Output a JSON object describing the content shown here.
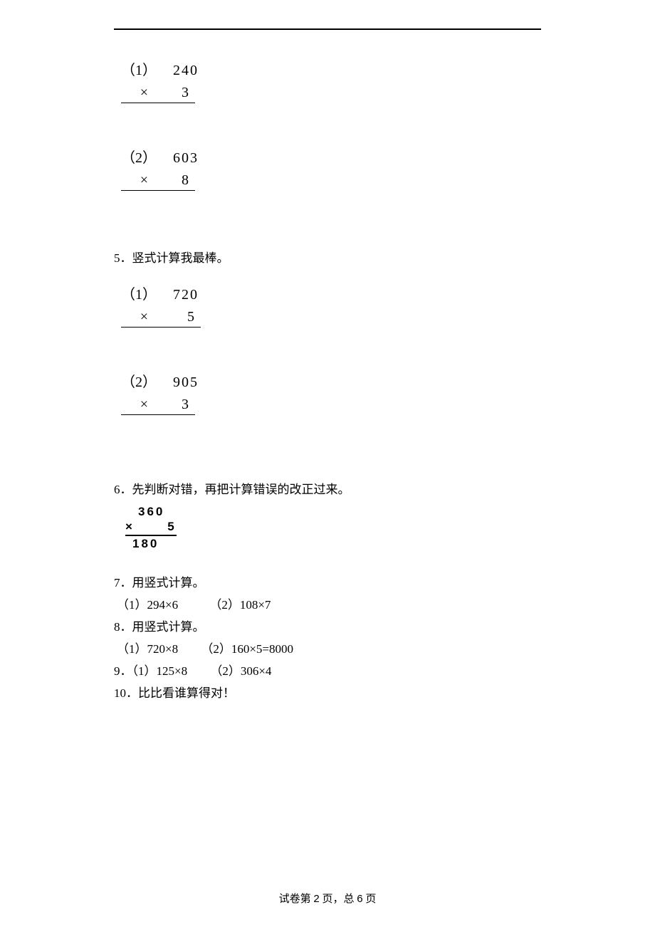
{
  "q4": {
    "p1": {
      "label": "（1）",
      "operand": "240",
      "sign": "×",
      "multiplier": "3"
    },
    "p2": {
      "label": "（2）",
      "operand": "603",
      "sign": "×",
      "multiplier": "8"
    }
  },
  "q5": {
    "title": "5．竖式计算我最棒。",
    "p1": {
      "label": "（1）",
      "operand": "720",
      "sign": "×",
      "multiplier": "5"
    },
    "p2": {
      "label": "（2）",
      "operand": "905",
      "sign": "×",
      "multiplier": "3"
    }
  },
  "q6": {
    "title": "6．先判断对错，再把计算错误的改正过来。",
    "top": "360",
    "sign": "×",
    "mult": "5",
    "result": "180"
  },
  "q7": {
    "title": "7．用竖式计算。",
    "p1": "（1）294×6",
    "p2": "（2）108×7"
  },
  "q8": {
    "title": "8．用竖式计算。",
    "p1": "（1）720×8",
    "p2": "（2）160×5=8000"
  },
  "q9": {
    "p1": "9．（1）125×8",
    "p2": "（2）306×4"
  },
  "q10": {
    "title": "10．比比看谁算得对！"
  },
  "footer": {
    "prefix": "试卷第",
    "current": "2",
    "mid": "页，总",
    "total": "6",
    "suffix": "页"
  }
}
